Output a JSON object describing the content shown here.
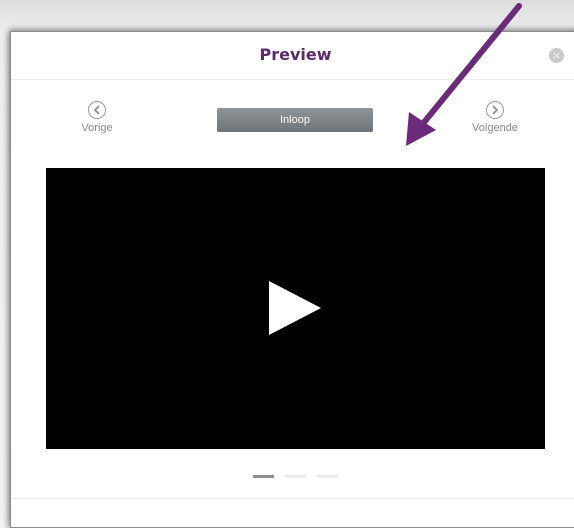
{
  "modal": {
    "title": "Preview",
    "close_icon": "close-icon",
    "close_glyph": "×"
  },
  "nav": {
    "prev_label": "Vorige",
    "prev_icon": "chevron-left-icon",
    "next_label": "Volgende",
    "next_icon": "chevron-right-icon"
  },
  "segment": {
    "label": "Inloop",
    "color": "#7d8287"
  },
  "video": {
    "play_icon": "play-icon",
    "background": "#000000"
  },
  "pager": {
    "count": 3,
    "active_index": 0
  },
  "annotation": {
    "arrow_icon": "arrow-annotation",
    "color": "#6b2a7a"
  },
  "colors": {
    "title": "#5c2a6b",
    "muted_text": "#8a8a8a"
  }
}
